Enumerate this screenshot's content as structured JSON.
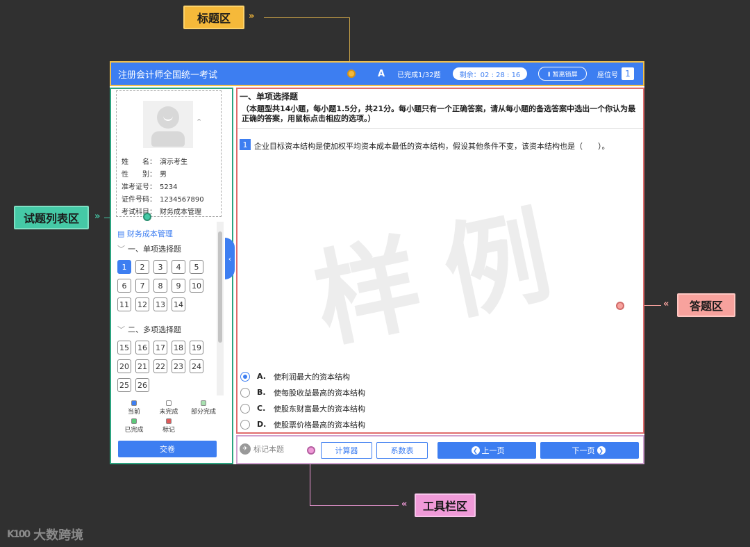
{
  "callouts": {
    "title_area": "标题区",
    "question_list_area": "试题列表区",
    "answer_area": "答题区",
    "toolbar_area": "工具栏区",
    "arrows_right": "»",
    "arrows_left": "«"
  },
  "colors": {
    "primary": "#3d7ef1",
    "title_callout": "#f5b93a",
    "list_callout": "#45c9a6",
    "answer_callout": "#f7a29d",
    "toolbar_callout": "#f09ad8"
  },
  "header": {
    "exam_name": "注册会计师全国统一考试",
    "font_icon": "A",
    "progress": "已完成1/32题",
    "timer": "剩余：02 : 28 : 16",
    "pause_button": "Ⅱ 暂离锁屏",
    "seat_label": "座位号",
    "seat_number": "1"
  },
  "candidate": {
    "rows": [
      {
        "key": "姓　　名：",
        "value": "演示考生"
      },
      {
        "key": "性　　别：",
        "value": "男"
      },
      {
        "key": "准考证号：",
        "value": "5234"
      },
      {
        "key": "证件号码：",
        "value": "1234567890"
      },
      {
        "key": "考试科目：",
        "value": "财务成本管理"
      }
    ]
  },
  "question_list": {
    "subject": "财务成本管理",
    "sections": [
      {
        "title": "一、单项选择题",
        "numbers": [
          "1",
          "2",
          "3",
          "4",
          "5",
          "6",
          "7",
          "8",
          "9",
          "10",
          "11",
          "12",
          "13",
          "14"
        ]
      },
      {
        "title": "二、多项选择题",
        "numbers": [
          "15",
          "16",
          "17",
          "18",
          "19",
          "20",
          "21",
          "22",
          "23",
          "24",
          "25",
          "26"
        ]
      }
    ],
    "current": "1",
    "legend": [
      {
        "label": "当前",
        "color": "#3d7ef1"
      },
      {
        "label": "未完成",
        "color": "#ffffff"
      },
      {
        "label": "部分完成",
        "color": "#a8e0b0"
      },
      {
        "label": "已完成",
        "color": "#5cc97a"
      },
      {
        "label": "标记",
        "color": "#e05a5a"
      }
    ],
    "submit": "交卷"
  },
  "question": {
    "section_heading": "一、单项选择题",
    "section_desc": "（本题型共14小题，每小题1.5分，共21分。每小题只有一个正确答案，请从每小题的备选答案中选出一个你认为最正确的答案，用鼠标点击相应的选项。）",
    "number": "1",
    "text": "企业目标资本结构是使加权平均资本成本最低的资本结构，假设其他条件不变，该资本结构也是（　　）。",
    "watermark": "样例",
    "options": [
      {
        "letter": "A.",
        "text": "使利润最大的资本结构",
        "checked": true
      },
      {
        "letter": "B.",
        "text": "使每股收益最高的资本结构",
        "checked": false
      },
      {
        "letter": "C.",
        "text": "使股东财富最大的资本结构",
        "checked": false
      },
      {
        "letter": "D.",
        "text": "使股票价格最高的资本结构",
        "checked": false
      }
    ]
  },
  "toolbar": {
    "mark": "标记本题",
    "calculator": "计算器",
    "tables": "系数表",
    "prev": "上一页",
    "next": "下一页"
  },
  "brand": {
    "name": "大数跨境",
    "mark": "K100"
  }
}
